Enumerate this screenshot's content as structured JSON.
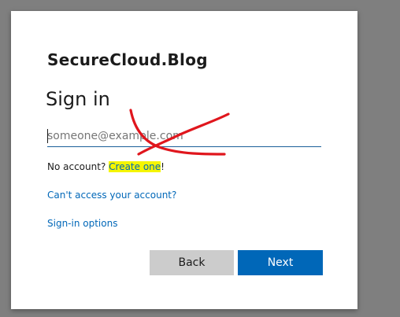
{
  "brand": {
    "logo_text": "SecureCloud.Blog"
  },
  "signin": {
    "title": "Sign in",
    "email_placeholder": "someone@example.com",
    "email_value": ""
  },
  "links": {
    "no_account_text": "No account?",
    "create_one_label": "Create one",
    "create_one_suffix": "!",
    "cant_access_label": "Can't access your account?",
    "signin_options_label": "Sign-in options"
  },
  "buttons": {
    "back_label": "Back",
    "next_label": "Next"
  },
  "colors": {
    "accent": "#0067b8",
    "highlight": "#f5f500",
    "annotation": "#e0161d",
    "backdrop": "#7f7f7f"
  },
  "annotation": {
    "icon": "red-cross-scribble-icon"
  }
}
